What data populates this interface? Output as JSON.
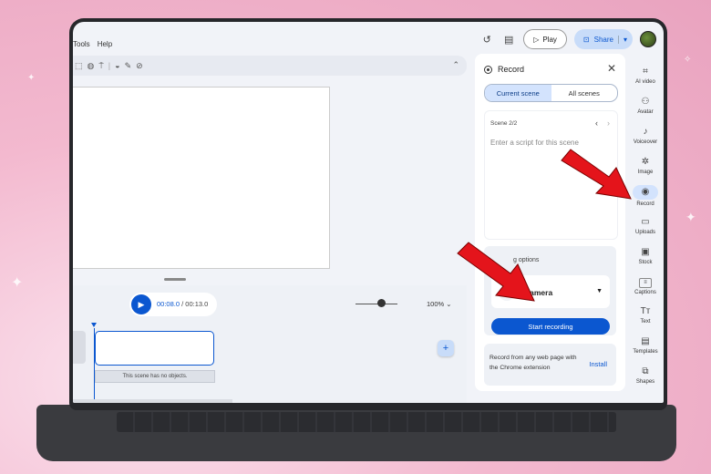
{
  "menu": {
    "items": [
      "Tools",
      "Help"
    ]
  },
  "topbar": {
    "play_label": "Play",
    "share_label": "Share"
  },
  "timeline": {
    "current_time": "00:08.0",
    "total_time": "/ 00:13.0",
    "zoom": "100%",
    "clip_empty_text": "This scene has no objects."
  },
  "panel": {
    "title": "Record",
    "tabs": [
      "Current scene",
      "All scenes"
    ],
    "scene_label": "Scene 2/2",
    "script_placeholder": "Enter a script for this scene",
    "options_title": "g options",
    "camera_label": "Camera",
    "start_label": "Start recording",
    "extension_text": "Record from any web page with the Chrome extension",
    "install_label": "Install"
  },
  "rail": {
    "items": [
      {
        "label": "AI video",
        "icon": "ai-video-icon",
        "glyph": "⌗"
      },
      {
        "label": "Avatar",
        "icon": "avatar-add-icon",
        "glyph": "⚇"
      },
      {
        "label": "Voiceover",
        "icon": "voiceover-icon",
        "glyph": "♪"
      },
      {
        "label": "Image",
        "icon": "image-icon",
        "glyph": "✲"
      },
      {
        "label": "Record",
        "icon": "record-icon",
        "glyph": "◉"
      },
      {
        "label": "Uploads",
        "icon": "folder-icon",
        "glyph": "▭"
      },
      {
        "label": "Stock",
        "icon": "stock-icon",
        "glyph": "▣"
      },
      {
        "label": "Captions",
        "icon": "captions-icon",
        "glyph": "≡"
      },
      {
        "label": "Text",
        "icon": "text-icon",
        "glyph": "Tт"
      },
      {
        "label": "Templates",
        "icon": "templates-icon",
        "glyph": "▤"
      },
      {
        "label": "Shapes",
        "icon": "shapes-icon",
        "glyph": "⧉"
      }
    ]
  },
  "colors": {
    "accent": "#0b57d0",
    "arrow": "#e4141b",
    "laptop": "#3a3b3f"
  }
}
